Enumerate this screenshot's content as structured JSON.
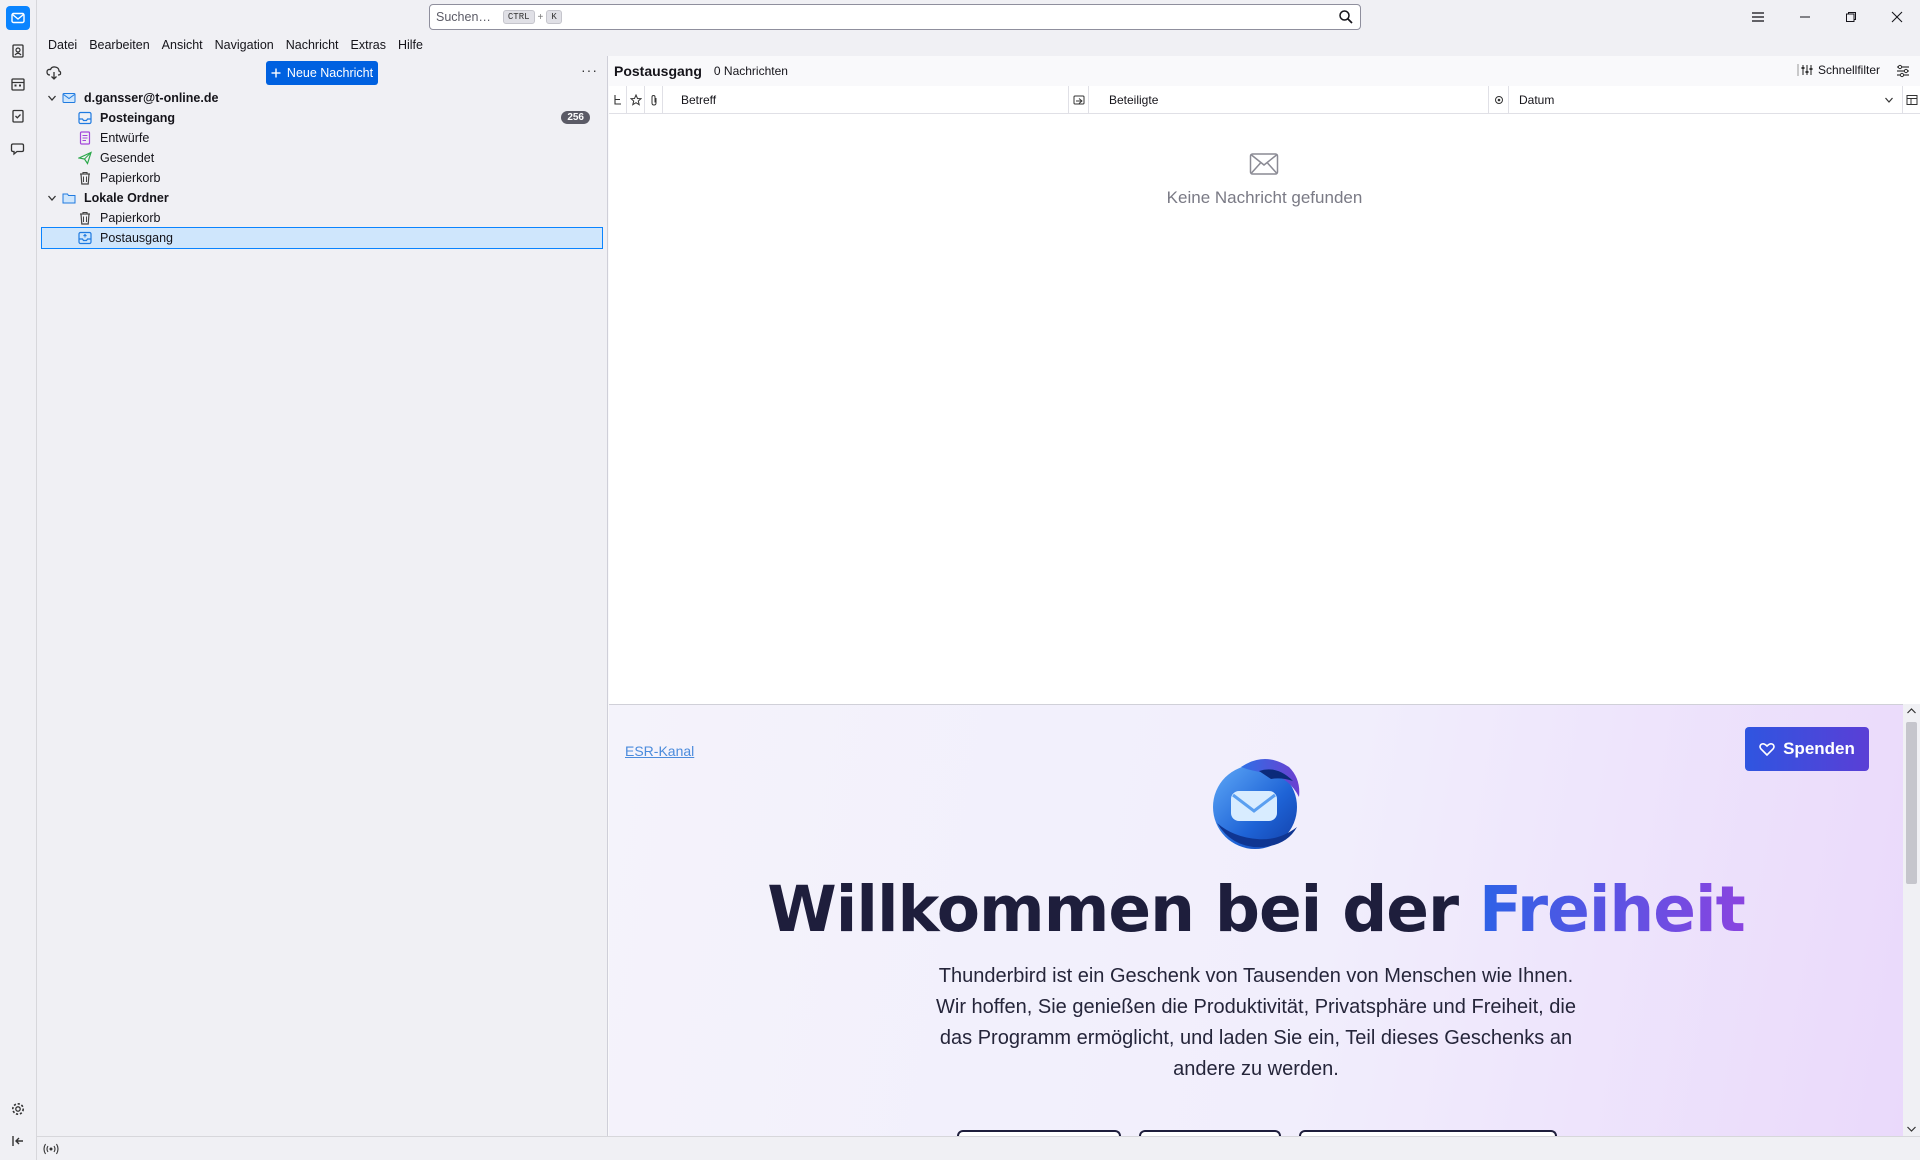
{
  "search": {
    "placeholder": "Suchen…",
    "key1": "CTRL",
    "plus": "+",
    "key2": "K"
  },
  "menu": [
    "Datei",
    "Bearbeiten",
    "Ansicht",
    "Navigation",
    "Nachricht",
    "Extras",
    "Hilfe"
  ],
  "folderpane": {
    "new_message": "Neue Nachricht",
    "more": "···",
    "account": "d.gansser@t-online.de",
    "inbox": "Posteingang",
    "inbox_badge": "256",
    "drafts": "Entwürfe",
    "sent": "Gesendet",
    "trash": "Papierkorb",
    "local": "Lokale Ordner",
    "local_trash": "Papierkorb",
    "outbox": "Postausgang"
  },
  "threadpane": {
    "folder": "Postausgang",
    "count": "0 Nachrichten",
    "quickfilter": "Schnellfilter",
    "columns": {
      "subject": "Betreff",
      "correspondents": "Beteiligte",
      "date": "Datum"
    },
    "empty": "Keine Nachricht gefunden"
  },
  "startpage": {
    "esr": "ESR-Kanal",
    "donate": "Spenden",
    "welcome_prefix": "Willkommen bei der",
    "welcome_highlight": "Freiheit",
    "intro_lines": [
      "Thunderbird ist ein Geschenk von Tausenden von Menschen wie Ihnen.",
      "Wir hoffen, Sie genießen die Produktivität, Privatsphäre und Freiheit, die",
      "das Programm ermöglicht, und laden Sie ein, Teil dieses Geschenks an",
      "andere zu werden."
    ]
  },
  "colors": {
    "accent": "#0061e0",
    "selection": "#cfe6fc",
    "badge": "#5b5b66"
  }
}
